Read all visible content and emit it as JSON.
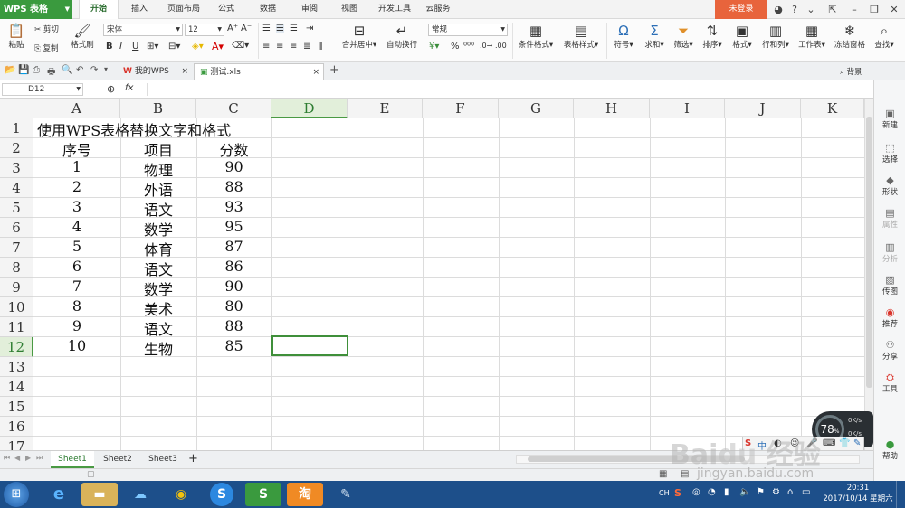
{
  "app": {
    "name": "WPS 表格",
    "login_label": "未登录"
  },
  "menu_tabs": [
    "开始",
    "插入",
    "页面布局",
    "公式",
    "数据",
    "审阅",
    "视图",
    "开发工具",
    "云服务"
  ],
  "active_menu_tab": "开始",
  "ribbon": {
    "paste": "粘贴",
    "cut": "剪切",
    "copy": "复制",
    "format_painter": "格式刷",
    "font_name": "宋体",
    "font_size": "12",
    "merge_center": "合并居中",
    "wrap_text": "自动换行",
    "number_format": "常规",
    "conditional_format": "条件格式",
    "table_style": "表格样式",
    "symbol": "符号",
    "sum": "求和",
    "filter": "筛选",
    "sort": "排序",
    "format": "格式",
    "row_col": "行和列",
    "worksheet": "工作表",
    "freeze": "冻结窗格",
    "find": "查找"
  },
  "doc_tabs": [
    {
      "label": "我的WPS"
    },
    {
      "label": "测试.xls"
    }
  ],
  "background_label": "背景",
  "name_box": "D12",
  "fx": "fx",
  "columns": [
    "A",
    "B",
    "C",
    "D",
    "E",
    "F",
    "G",
    "H",
    "I",
    "J",
    "K"
  ],
  "rows": [
    "1",
    "2",
    "3",
    "4",
    "5",
    "6",
    "7",
    "8",
    "9",
    "10",
    "11",
    "12",
    "13",
    "14",
    "15",
    "16",
    "17"
  ],
  "selected_cell": "D12",
  "cells": {
    "title": "使用WPS表格替换文字和格式",
    "header": [
      "序号",
      "项目",
      "分数"
    ],
    "data": [
      [
        "1",
        "物理",
        "90"
      ],
      [
        "2",
        "外语",
        "88"
      ],
      [
        "3",
        "语文",
        "93"
      ],
      [
        "4",
        "数学",
        "95"
      ],
      [
        "5",
        "体育",
        "87"
      ],
      [
        "6",
        "语文",
        "86"
      ],
      [
        "7",
        "数学",
        "90"
      ],
      [
        "8",
        "美术",
        "80"
      ],
      [
        "9",
        "语文",
        "88"
      ],
      [
        "10",
        "生物",
        "85"
      ]
    ]
  },
  "sheet_tabs": [
    "Sheet1",
    "Sheet2",
    "Sheet3"
  ],
  "active_sheet": "Sheet1",
  "right_panel": [
    "新建",
    "选择",
    "形状",
    "属性",
    "分析",
    "传图",
    "推荐",
    "分享",
    "工具",
    "帮助"
  ],
  "net_widget": {
    "percent": "78",
    "up": "0K/s",
    "down": "0K/s"
  },
  "taskbar": {
    "lang": "CH",
    "time": "20:31",
    "date": "2017/10/14 星期六"
  },
  "watermark": "jingyan.baidu.com",
  "colors": {
    "brand_green": "#3a9a3e",
    "login_orange": "#e8643c",
    "selection_green": "#4a9a43",
    "taskbar_blue": "#1d4f8a"
  }
}
